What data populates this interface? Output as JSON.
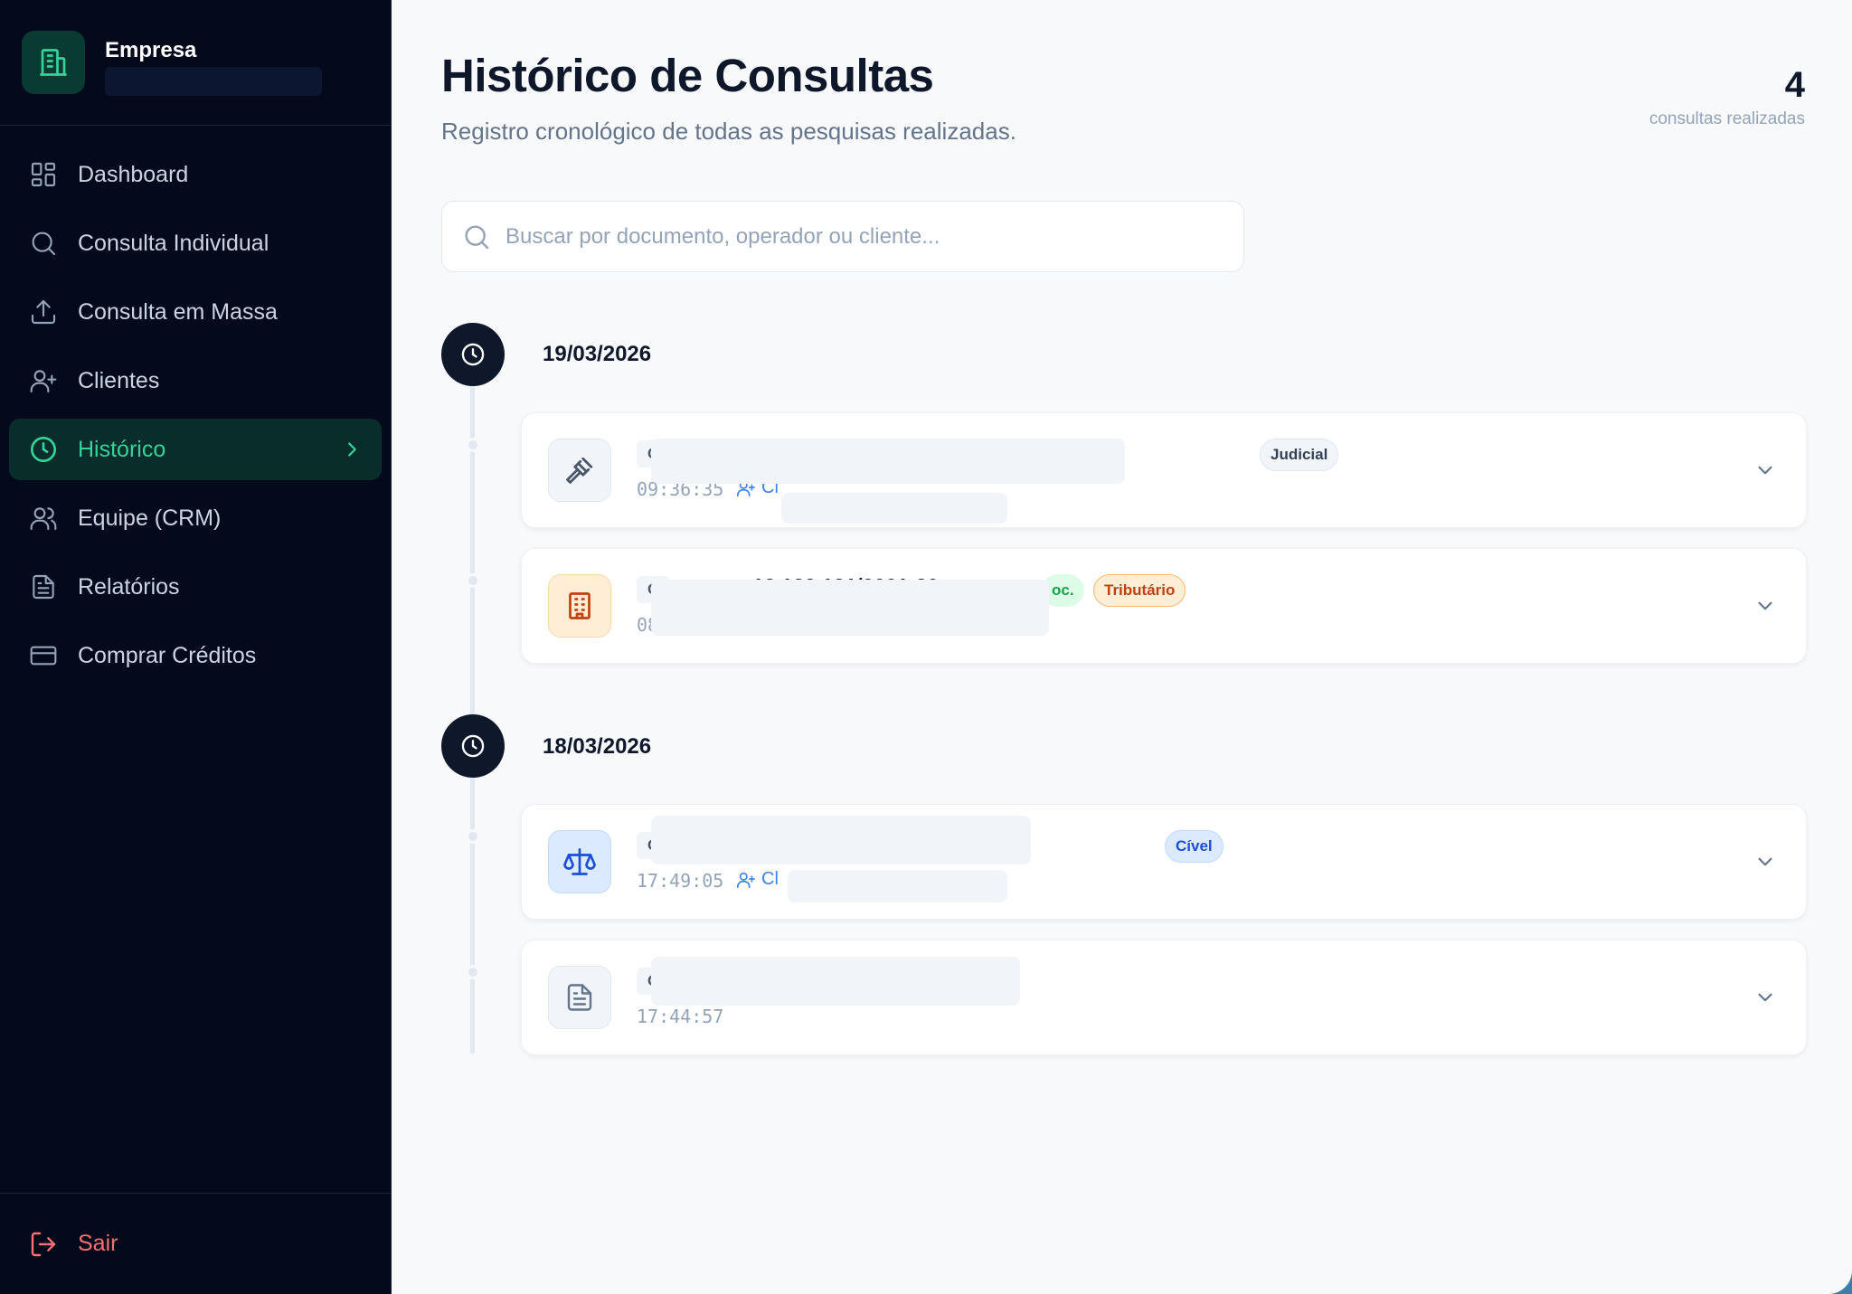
{
  "sidebar": {
    "brand_name": "Empresa",
    "nav": [
      {
        "label": "Dashboard",
        "icon": "dashboard-icon"
      },
      {
        "label": "Consulta Individual",
        "icon": "search-icon"
      },
      {
        "label": "Consulta em Massa",
        "icon": "upload-icon"
      },
      {
        "label": "Clientes",
        "icon": "user-plus-icon"
      },
      {
        "label": "Histórico",
        "icon": "clock-icon",
        "active": true
      },
      {
        "label": "Equipe (CRM)",
        "icon": "users-icon"
      },
      {
        "label": "Relatórios",
        "icon": "report-icon"
      },
      {
        "label": "Comprar Créditos",
        "icon": "credit-card-icon"
      }
    ],
    "logout_label": "Sair"
  },
  "header": {
    "title": "Histórico de Consultas",
    "subtitle": "Registro cronológico de todas as pesquisas realizadas.",
    "count": "4",
    "count_label": "consultas realizadas"
  },
  "search": {
    "placeholder": "Buscar por documento, operador ou cliente..."
  },
  "groups": [
    {
      "date": "19/03/2026",
      "entries": [
        {
          "doc_type": "C",
          "badge": "Judicial",
          "time": "09:36:35",
          "client": "Cl",
          "icon": "gavel-icon"
        },
        {
          "doc_type": "C",
          "doc_number": "12.123.121/0001-20",
          "status_badge": "oc.",
          "badge": "Tributário",
          "time": "08",
          "icon": "building-icon"
        }
      ]
    },
    {
      "date": "18/03/2026",
      "entries": [
        {
          "doc_type": "C",
          "badge": "Cível",
          "time": "17:49:05",
          "client": "Cl",
          "icon": "scale-icon"
        },
        {
          "doc_type": "C",
          "time": "17:44:57",
          "icon": "document-icon"
        }
      ]
    }
  ],
  "colors": {
    "sidebar_bg": "#040a1c",
    "accent": "#34d399",
    "main_bg": "#f7f9fb",
    "logout": "#f87171"
  }
}
